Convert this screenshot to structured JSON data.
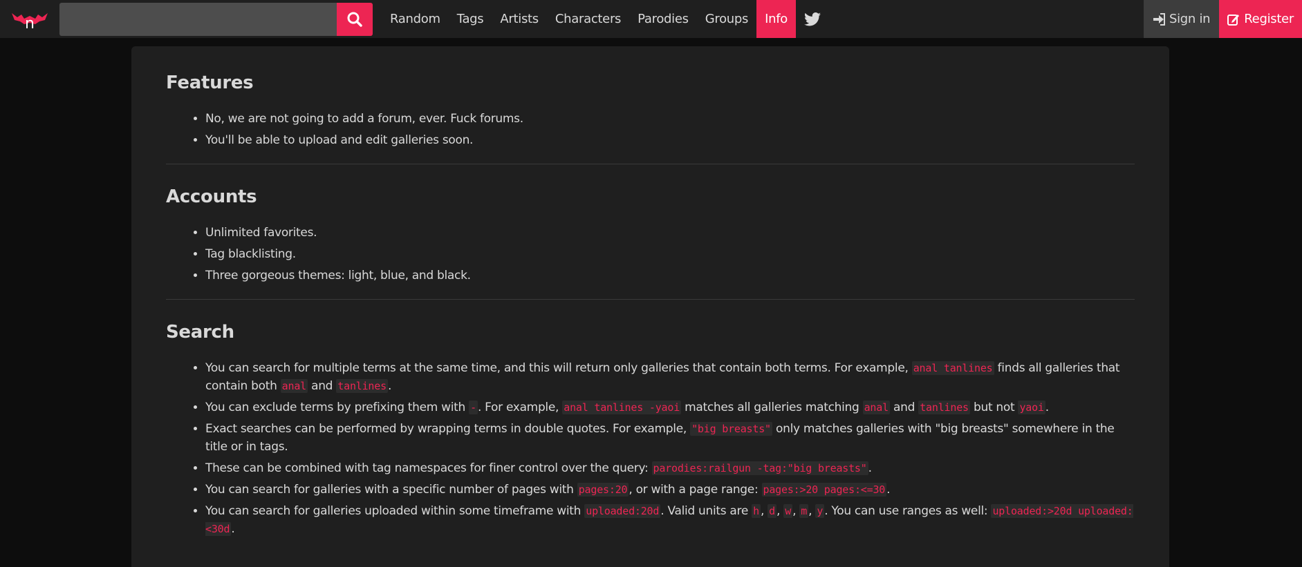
{
  "colors": {
    "accent": "#ed2553",
    "nav_bg": "#1f1f1f",
    "page_bg": "#0d0d0d"
  },
  "nav": {
    "logo": "n",
    "search_placeholder": "",
    "search_icon": "search-icon",
    "links": [
      "Random",
      "Tags",
      "Artists",
      "Characters",
      "Parodies",
      "Groups",
      "Info"
    ],
    "active": "Info",
    "twitter_icon": "twitter-icon",
    "signin": "Sign in",
    "register": "Register"
  },
  "sections": {
    "features": {
      "title": "Features",
      "items": [
        "No, we are not going to add a forum, ever. Fuck forums.",
        "You'll be able to upload and edit galleries soon."
      ]
    },
    "accounts": {
      "title": "Accounts",
      "items": [
        "Unlimited favorites.",
        "Tag blacklisting.",
        "Three gorgeous themes: light, blue, and black."
      ]
    },
    "search": {
      "title": "Search",
      "item1": {
        "t1": "You can search for multiple terms at the same time, and this will return only galleries that contain both terms. For example, ",
        "c1": "anal tanlines",
        "t2": " finds all galleries that contain both ",
        "c2": "anal",
        "t3": " and ",
        "c3": "tanlines",
        "t4": "."
      },
      "item2": {
        "t1": "You can exclude terms by prefixing them with ",
        "c1": "-",
        "t2": ". For example, ",
        "c2": "anal tanlines -yaoi",
        "t3": " matches all galleries matching ",
        "c3": "anal",
        "t4": " and ",
        "c4": "tanlines",
        "t5": " but not ",
        "c5": "yaoi",
        "t6": "."
      },
      "item3": {
        "t1": "Exact searches can be performed by wrapping terms in double quotes. For example, ",
        "c1": "\"big breasts\"",
        "t2": " only matches galleries with \"big breasts\" somewhere in the title or in tags."
      },
      "item4": {
        "t1": "These can be combined with tag namespaces for finer control over the query: ",
        "c1": "parodies:railgun -tag:\"big breasts\"",
        "t2": "."
      },
      "item5": {
        "t1": "You can search for galleries with a specific number of pages with ",
        "c1": "pages:20",
        "t2": ", or with a page range: ",
        "c2": "pages:>20 pages:<=30",
        "t3": "."
      },
      "item6": {
        "t1": "You can search for galleries uploaded within some timeframe with ",
        "c1": "uploaded:20d",
        "t2": ". Valid units are ",
        "c2": "h",
        "t3": ", ",
        "c3": "d",
        "t4": ", ",
        "c4": "w",
        "t5": ", ",
        "c5": "m",
        "t6": ", ",
        "c6": "y",
        "t7": ". You can use ranges as well: ",
        "c7": "uploaded:>20d uploaded:<30d",
        "t8": "."
      }
    }
  }
}
